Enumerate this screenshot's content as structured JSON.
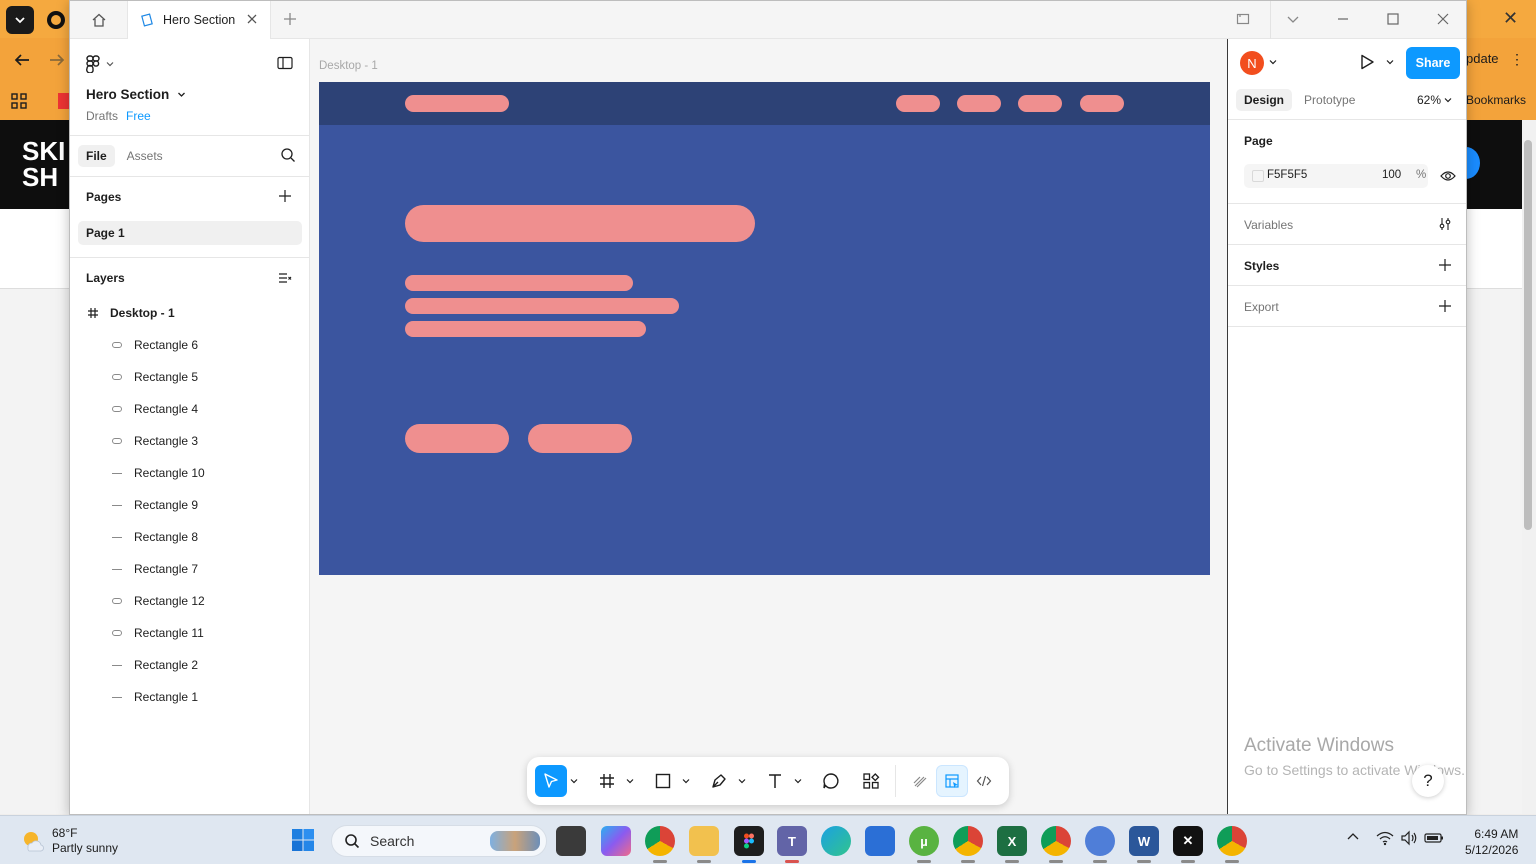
{
  "browser": {
    "update_label": "pdate",
    "bookmarks_label": "Bookmarks",
    "banner_text_line1": "SKI",
    "banner_text_line2": "SH"
  },
  "window": {
    "home_icon": "home-icon",
    "tab_title": "Hero Section",
    "new_tab_icon": "plus-icon"
  },
  "left_panel": {
    "file_title": "Hero Section",
    "location": "Drafts",
    "plan_badge": "Free",
    "tabs": [
      {
        "label": "File",
        "active": true
      },
      {
        "label": "Assets",
        "active": false
      }
    ],
    "pages_title": "Pages",
    "pages": [
      {
        "label": "Page 1",
        "selected": true
      }
    ],
    "layers_title": "Layers",
    "frame_layer": "Desktop - 1",
    "layers": [
      {
        "label": "Rectangle 6",
        "icon": "rounded-rect-icon"
      },
      {
        "label": "Rectangle 5",
        "icon": "rounded-rect-icon"
      },
      {
        "label": "Rectangle 4",
        "icon": "rounded-rect-icon"
      },
      {
        "label": "Rectangle 3",
        "icon": "rounded-rect-icon"
      },
      {
        "label": "Rectangle 10",
        "icon": "line-rect-icon"
      },
      {
        "label": "Rectangle 9",
        "icon": "line-rect-icon"
      },
      {
        "label": "Rectangle 8",
        "icon": "line-rect-icon"
      },
      {
        "label": "Rectangle 7",
        "icon": "line-rect-icon"
      },
      {
        "label": "Rectangle 12",
        "icon": "rounded-rect-icon"
      },
      {
        "label": "Rectangle 11",
        "icon": "rounded-rect-icon"
      },
      {
        "label": "Rectangle 2",
        "icon": "line-rect-icon"
      },
      {
        "label": "Rectangle 1",
        "icon": "line-rect-icon"
      }
    ]
  },
  "canvas": {
    "frame_label": "Desktop - 1",
    "background": "#F5F5F5",
    "frame_color": "#3B559F",
    "nav_color": "#2D4276",
    "shape_color": "#EF8F8F"
  },
  "right_panel": {
    "avatar_initial": "N",
    "share_label": "Share",
    "tabs": [
      {
        "label": "Design",
        "active": true
      },
      {
        "label": "Prototype",
        "active": false
      }
    ],
    "zoom": "62%",
    "page_section": "Page",
    "page_fill_hex": "F5F5F5",
    "page_fill_opacity": "100",
    "percent_sign": "%",
    "variables_label": "Variables",
    "styles_label": "Styles",
    "export_label": "Export",
    "watermark_title": "Activate Windows",
    "watermark_sub": "Go to Settings to activate Windows.",
    "help_label": "?"
  },
  "taskbar": {
    "temperature": "68°F",
    "weather": "Partly sunny",
    "search_label": "Search",
    "time": "6:49 AM",
    "date": "5/12/2026"
  }
}
